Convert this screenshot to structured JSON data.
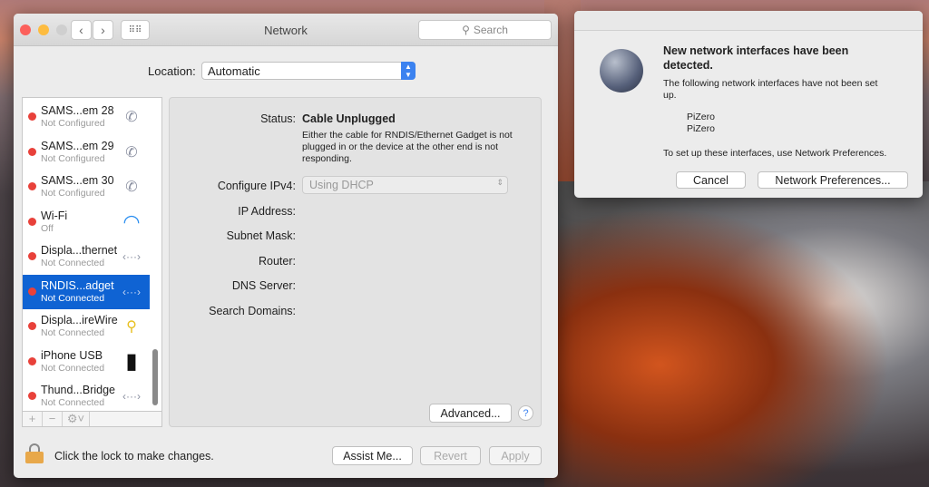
{
  "window": {
    "title": "Network",
    "search_placeholder": "Search",
    "location_label": "Location:",
    "location_value": "Automatic"
  },
  "interfaces": [
    {
      "name": "SAMS...em 28",
      "status": "Not Configured",
      "icon": "phone-icon"
    },
    {
      "name": "SAMS...em 29",
      "status": "Not Configured",
      "icon": "phone-icon"
    },
    {
      "name": "SAMS...em 30",
      "status": "Not Configured",
      "icon": "phone-icon"
    },
    {
      "name": "Wi-Fi",
      "status": "Off",
      "icon": "wifi-icon"
    },
    {
      "name": "Displa...thernet",
      "status": "Not Connected",
      "icon": "ethernet-icon"
    },
    {
      "name": "RNDIS...adget",
      "status": "Not Connected",
      "icon": "ethernet-icon",
      "selected": true
    },
    {
      "name": "Displa...ireWire",
      "status": "Not Connected",
      "icon": "firewire-icon"
    },
    {
      "name": "iPhone USB",
      "status": "Not Connected",
      "icon": "iphone-icon"
    },
    {
      "name": "Thund...Bridge",
      "status": "Not Connected",
      "icon": "ethernet-icon"
    }
  ],
  "detail": {
    "status_label": "Status:",
    "status_value": "Cable Unplugged",
    "status_desc": "Either the cable for RNDIS/Ethernet Gadget is not plugged in or the device at the other end is not responding.",
    "ipv4_label": "Configure IPv4:",
    "ipv4_value": "Using DHCP",
    "ip_label": "IP Address:",
    "subnet_label": "Subnet Mask:",
    "router_label": "Router:",
    "dns_label": "DNS Server:",
    "search_label": "Search Domains:",
    "advanced": "Advanced...",
    "help": "?"
  },
  "footer": {
    "lock_text": "Click the lock to make changes.",
    "assist": "Assist Me...",
    "revert": "Revert",
    "apply": "Apply"
  },
  "dialog": {
    "title": "New network interfaces have been detected.",
    "body": "The following network interfaces have not been set up.",
    "items": [
      "PiZero",
      "PiZero"
    ],
    "footer": "To set up these interfaces, use Network Preferences.",
    "cancel": "Cancel",
    "prefs": "Network Preferences..."
  },
  "colors": {
    "accent": "#0f63d3",
    "status_red": "#e8413a"
  }
}
